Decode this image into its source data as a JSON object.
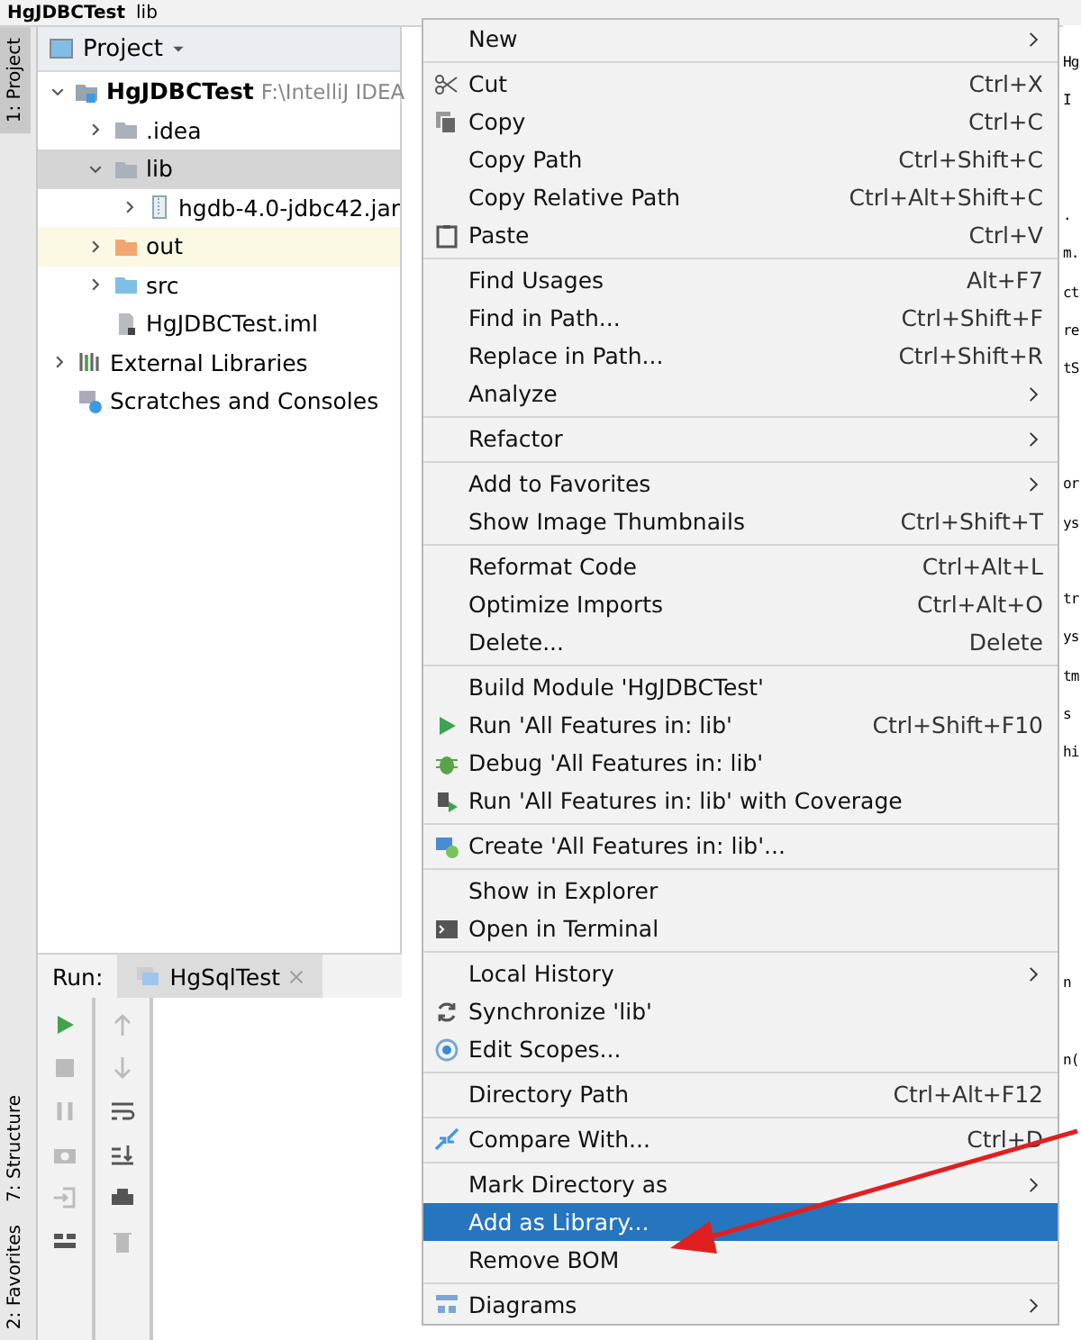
{
  "breadcrumbs": [
    "HgJDBCTest",
    "lib"
  ],
  "side_tabs_top": [
    {
      "label": "1: Project",
      "selected": true
    }
  ],
  "side_tabs_bottom": [
    {
      "label": "7: Structure",
      "selected": false
    },
    {
      "label": "2: Favorites",
      "selected": false
    }
  ],
  "project_panel": {
    "title": "Project",
    "tree": [
      {
        "label": "HgJDBCTest",
        "kind": "module",
        "path": "F:\\IntelliJ IDEA",
        "expanded": true,
        "selected": false,
        "highlighted": false,
        "children": [
          {
            "label": ".idea",
            "kind": "folder",
            "color": "#a9b1ba",
            "expanded": false,
            "selected": false,
            "highlighted": false
          },
          {
            "label": "lib",
            "kind": "folder",
            "color": "#a9b1ba",
            "expanded": true,
            "selected": true,
            "highlighted": false,
            "children": [
              {
                "label": "hgdb-4.0-jdbc42.jar",
                "kind": "jar",
                "expanded": false,
                "selected": false,
                "highlighted": false
              }
            ]
          },
          {
            "label": "out",
            "kind": "folder",
            "color": "#f0a66e",
            "expanded": false,
            "selected": false,
            "highlighted": true
          },
          {
            "label": "src",
            "kind": "folder",
            "color": "#7fbfe6",
            "expanded": false,
            "selected": false,
            "highlighted": false
          },
          {
            "label": "HgJDBCTest.iml",
            "kind": "file",
            "selected": false,
            "highlighted": false
          }
        ]
      },
      {
        "label": "External Libraries",
        "kind": "libraries",
        "expanded": false,
        "selected": false,
        "highlighted": false
      },
      {
        "label": "Scratches and Consoles",
        "kind": "scratches",
        "selected": false,
        "highlighted": false
      }
    ]
  },
  "run_panel": {
    "label": "Run:",
    "tabs": [
      {
        "label": "HgSqlTest",
        "selected": true
      }
    ]
  },
  "editor_fragments": [
    [
      "Hg",
      "I"
    ],
    [
      ".",
      "m.",
      "ct",
      "re",
      "tS"
    ],
    [
      "or",
      "ys"
    ],
    [
      "tr",
      "ys",
      "tm",
      "s",
      "hi"
    ],
    [
      "n"
    ],
    [
      "n("
    ]
  ],
  "context_menu": [
    [
      {
        "label": "New",
        "submenu": true,
        "selected": false
      }
    ],
    [
      {
        "label": "Cut",
        "kind": "cut",
        "shortcut": "Ctrl+X",
        "selected": false
      },
      {
        "label": "Copy",
        "kind": "copy",
        "shortcut": "Ctrl+C",
        "selected": false
      },
      {
        "label": "Copy Path",
        "shortcut": "Ctrl+Shift+C",
        "selected": false
      },
      {
        "label": "Copy Relative Path",
        "shortcut": "Ctrl+Alt+Shift+C",
        "selected": false
      },
      {
        "label": "Paste",
        "kind": "paste",
        "shortcut": "Ctrl+V",
        "selected": false
      }
    ],
    [
      {
        "label": "Find Usages",
        "shortcut": "Alt+F7",
        "selected": false
      },
      {
        "label": "Find in Path...",
        "shortcut": "Ctrl+Shift+F",
        "selected": false
      },
      {
        "label": "Replace in Path...",
        "shortcut": "Ctrl+Shift+R",
        "selected": false
      },
      {
        "label": "Analyze",
        "submenu": true,
        "selected": false
      }
    ],
    [
      {
        "label": "Refactor",
        "submenu": true,
        "selected": false
      }
    ],
    [
      {
        "label": "Add to Favorites",
        "submenu": true,
        "selected": false
      },
      {
        "label": "Show Image Thumbnails",
        "shortcut": "Ctrl+Shift+T",
        "selected": false
      }
    ],
    [
      {
        "label": "Reformat Code",
        "shortcut": "Ctrl+Alt+L",
        "selected": false
      },
      {
        "label": "Optimize Imports",
        "shortcut": "Ctrl+Alt+O",
        "selected": false
      },
      {
        "label": "Delete...",
        "shortcut": "Delete",
        "selected": false
      }
    ],
    [
      {
        "label": "Build Module 'HgJDBCTest'",
        "selected": false
      },
      {
        "label": "Run 'All Features in: lib'",
        "kind": "run",
        "shortcut": "Ctrl+Shift+F10",
        "selected": false
      },
      {
        "label": "Debug 'All Features in: lib'",
        "kind": "debug",
        "selected": false
      },
      {
        "label": "Run 'All Features in: lib' with Coverage",
        "kind": "coverage",
        "selected": false
      }
    ],
    [
      {
        "label": "Create 'All Features in: lib'...",
        "kind": "create",
        "selected": false
      }
    ],
    [
      {
        "label": "Show in Explorer",
        "selected": false
      },
      {
        "label": "Open in Terminal",
        "kind": "terminal",
        "selected": false
      }
    ],
    [
      {
        "label": "Local History",
        "submenu": true,
        "selected": false
      },
      {
        "label": "Synchronize 'lib'",
        "kind": "sync",
        "selected": false
      },
      {
        "label": "Edit Scopes...",
        "kind": "scope",
        "selected": false
      }
    ],
    [
      {
        "label": "Directory Path",
        "shortcut": "Ctrl+Alt+F12",
        "selected": false
      }
    ],
    [
      {
        "label": "Compare With...",
        "kind": "compare",
        "shortcut": "Ctrl+D",
        "selected": false
      }
    ],
    [
      {
        "label": "Mark Directory as",
        "submenu": true,
        "selected": false
      },
      {
        "label": "Add as Library...",
        "selected": true
      },
      {
        "label": "Remove BOM",
        "selected": false
      }
    ],
    [
      {
        "label": "Diagrams",
        "kind": "diagram",
        "submenu": true,
        "selected": false
      }
    ]
  ]
}
